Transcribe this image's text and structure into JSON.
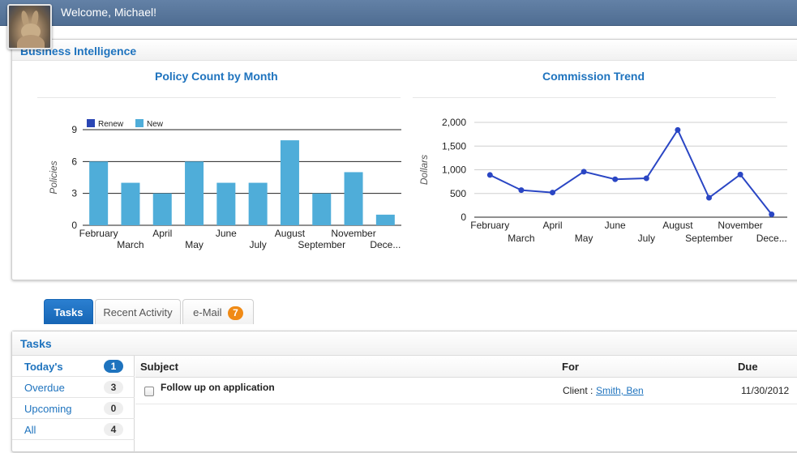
{
  "header": {
    "welcome": "Welcome, Michael!"
  },
  "bi": {
    "title": "Business Intelligence"
  },
  "charts": {
    "policy": {
      "title": "Policy Count by Month",
      "ylabel": "Policies",
      "legend": [
        {
          "name": "Renew",
          "color": "#2a46b4"
        },
        {
          "name": "New",
          "color": "#4fadd9"
        }
      ]
    },
    "commission": {
      "title": "Commission Trend",
      "ylabel": "Dollars",
      "color": "#2a46c4"
    }
  },
  "chart_data": [
    {
      "type": "bar",
      "title": "Policy Count by Month",
      "ylabel": "Policies",
      "categories": [
        "February",
        "March",
        "April",
        "May",
        "June",
        "July",
        "August",
        "September",
        "November",
        "Dece..."
      ],
      "series": [
        {
          "name": "Renew",
          "values": [
            0,
            0,
            0,
            0,
            0,
            0,
            0,
            0,
            0,
            0
          ]
        },
        {
          "name": "New",
          "values": [
            6,
            4,
            3,
            6,
            4,
            4,
            8,
            3,
            5,
            1
          ]
        }
      ],
      "ylim": [
        0,
        9
      ],
      "yticks": [
        0,
        3,
        6,
        9
      ],
      "legend_position": "top"
    },
    {
      "type": "line",
      "title": "Commission Trend",
      "ylabel": "Dollars",
      "categories": [
        "February",
        "March",
        "April",
        "May",
        "June",
        "July",
        "August",
        "September",
        "November",
        "Dece..."
      ],
      "series": [
        {
          "values": [
            890,
            570,
            520,
            960,
            800,
            820,
            1840,
            410,
            900,
            60
          ]
        }
      ],
      "ylim": [
        0,
        2000
      ],
      "yticks": [
        "0",
        "500",
        "1,000",
        "1,500",
        "2,000"
      ]
    }
  ],
  "tabs": [
    {
      "label": "Tasks",
      "active": true
    },
    {
      "label": "Recent Activity",
      "active": false
    },
    {
      "label": "e-Mail",
      "badge": "7",
      "active": false
    }
  ],
  "tasks": {
    "title": "Tasks",
    "nav": [
      {
        "label": "Today's",
        "count": "1",
        "active": true
      },
      {
        "label": "Overdue",
        "count": "3"
      },
      {
        "label": "Upcoming",
        "count": "0"
      },
      {
        "label": "All",
        "count": "4"
      }
    ],
    "columns": {
      "subject": "Subject",
      "for": "For",
      "due": "Due"
    },
    "rows": [
      {
        "subject": "Follow up on application",
        "for_prefix": "Client :",
        "for_link": "Smith, Ben",
        "due": "11/30/2012"
      }
    ]
  }
}
